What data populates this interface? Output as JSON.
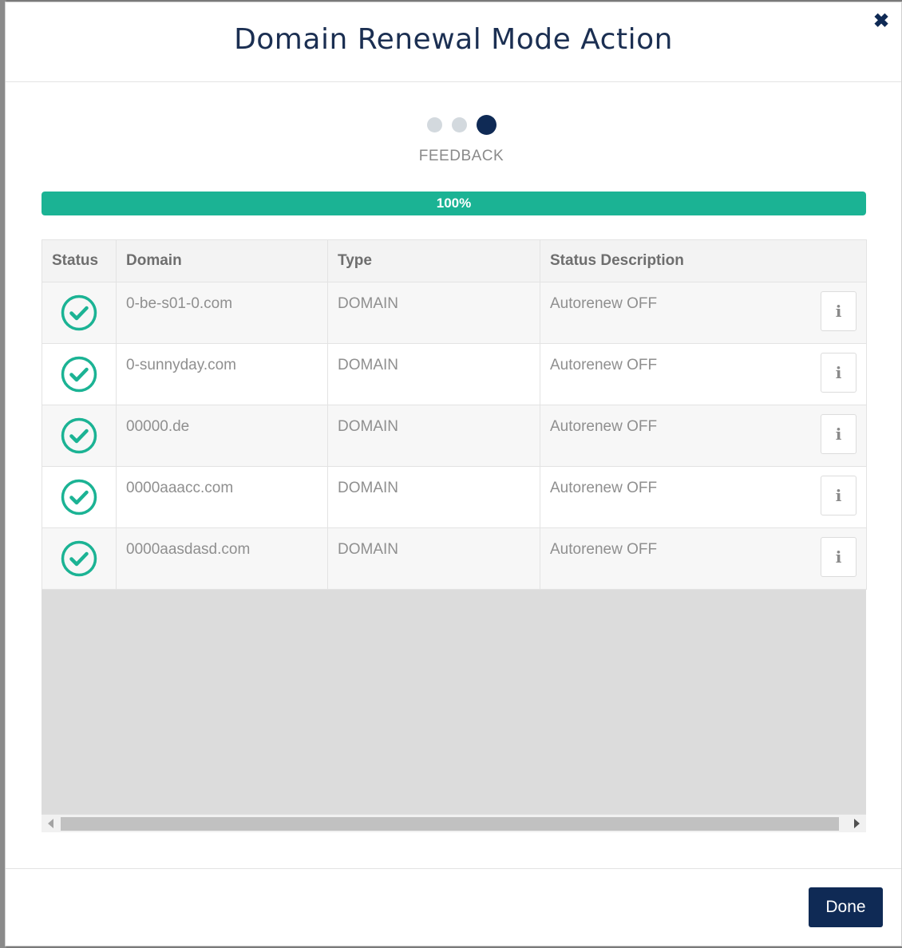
{
  "modal": {
    "title": "Domain Renewal Mode Action",
    "close_icon": "close-icon"
  },
  "steps": {
    "total": 3,
    "current": 3,
    "label": "FEEDBACK"
  },
  "progress": {
    "value": 100,
    "text": "100%",
    "color": "#1bb394"
  },
  "table": {
    "columns": [
      "Status",
      "Domain",
      "Type",
      "Status Description"
    ],
    "rows": [
      {
        "status_icon": "check-circle-icon",
        "domain": "0-be-s01-0.com",
        "type": "DOMAIN",
        "description": "Autorenew OFF"
      },
      {
        "status_icon": "check-circle-icon",
        "domain": "0-sunnyday.com",
        "type": "DOMAIN",
        "description": "Autorenew OFF"
      },
      {
        "status_icon": "check-circle-icon",
        "domain": "00000.de",
        "type": "DOMAIN",
        "description": "Autorenew OFF"
      },
      {
        "status_icon": "check-circle-icon",
        "domain": "0000aaacc.com",
        "type": "DOMAIN",
        "description": "Autorenew OFF"
      },
      {
        "status_icon": "check-circle-icon",
        "domain": "0000aasdasd.com",
        "type": "DOMAIN",
        "description": "Autorenew OFF"
      }
    ]
  },
  "info_button": {
    "icon": "info-icon",
    "glyph": "i"
  },
  "footer": {
    "done_label": "Done"
  },
  "colors": {
    "brand": "#0f2a55",
    "success": "#1bb394"
  }
}
